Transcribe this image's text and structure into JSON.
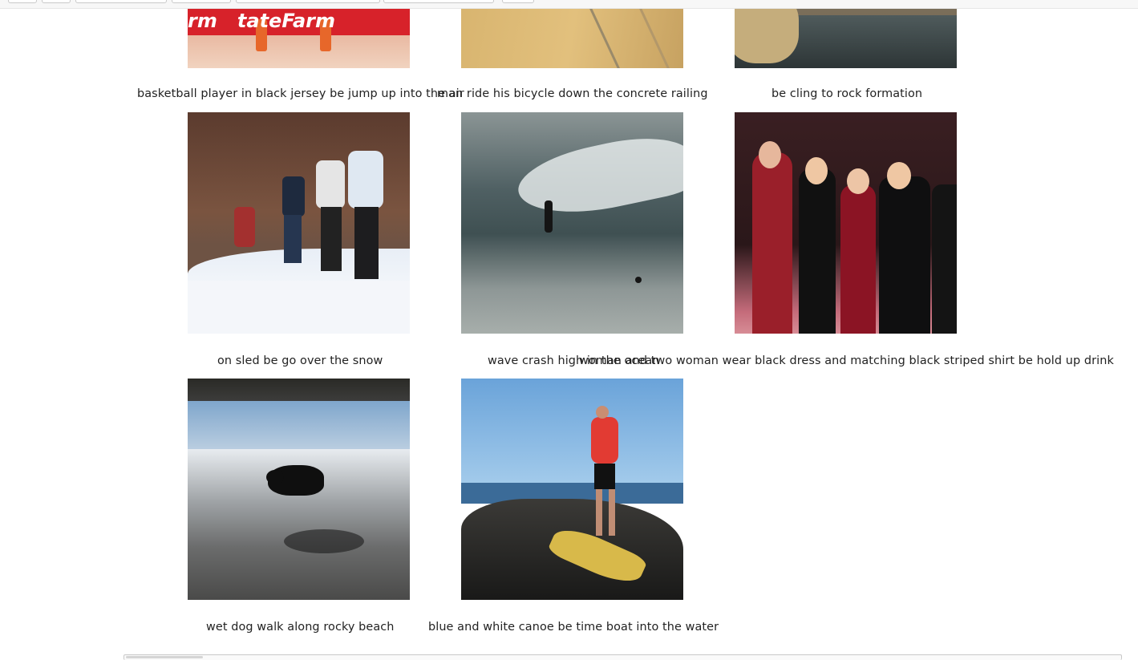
{
  "captions": {
    "r1c1": "basketball player in black jersey be jump up into the air",
    "r1c2": "man ride his bicycle down the concrete railing",
    "r1c3": "be cling to rock formation",
    "r2c1": "on sled be go over the snow",
    "r2c2": "wave crash high in the ocean",
    "r2c3": "woman and two woman wear black dress and matching black striped shirt be hold up drink",
    "r3c1": "wet dog walk along rocky beach",
    "r3c2": "blue and white canoe be time boat into the water"
  },
  "images": {
    "r1c1": "basketball-court-photo",
    "r1c2": "concrete-railing-photo",
    "r1c3": "rock-water-photo",
    "r2c1": "skiers-snow-photo",
    "r2c2": "surfer-wave-photo",
    "r2c3": "women-party-photo",
    "r3c1": "dog-beach-photo",
    "r3c2": "man-kayak-photo"
  },
  "banner_text": "rm   tateFarm",
  "colors": {
    "background": "#ffffff",
    "caption_text": "#222222",
    "banner_red": "#d7222a"
  }
}
